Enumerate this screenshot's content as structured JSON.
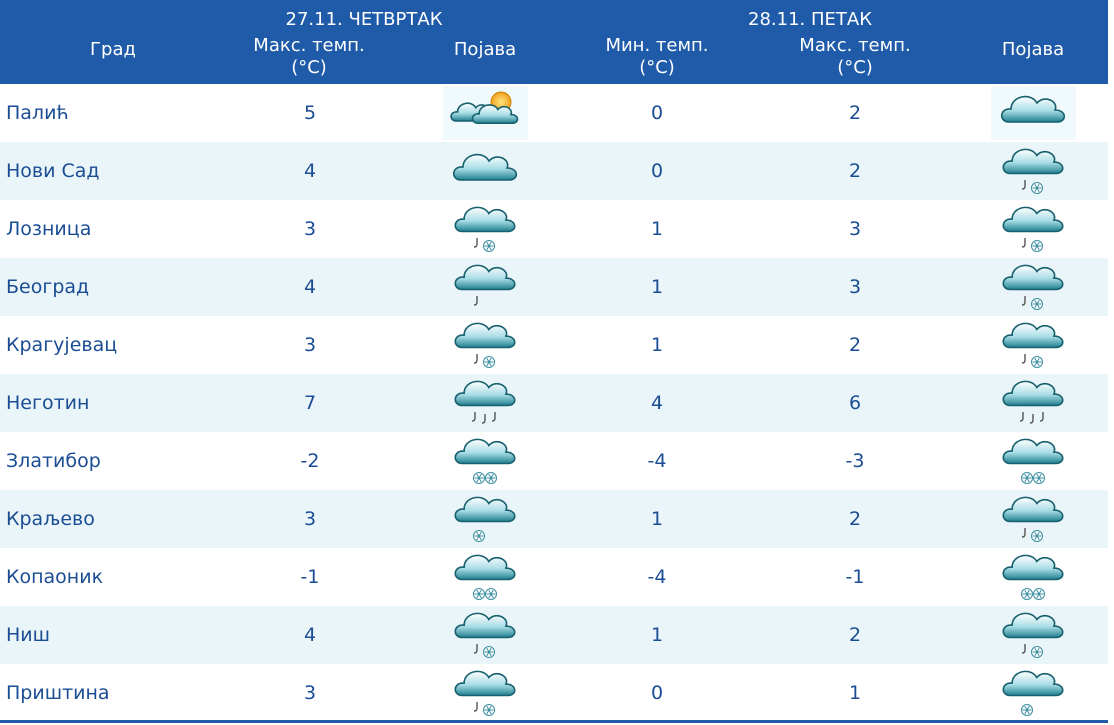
{
  "header": {
    "date1": "27.11. ЧЕТВРТАК",
    "date2": "28.11. ПЕТАК",
    "city": "Град",
    "max_temp": "Макс. темп.",
    "min_temp": "Мин. темп.",
    "unit": "(°C)",
    "phenomenon": "Појава"
  },
  "rows": [
    {
      "city": "Палић",
      "max1": "5",
      "icon1": "partly-cloudy-icon",
      "min2": "0",
      "max2": "2",
      "icon2": "cloudy-icon"
    },
    {
      "city": "Нови Сад",
      "max1": "4",
      "icon1": "cloudy-icon",
      "min2": "0",
      "max2": "2",
      "icon2": "sleet-icon"
    },
    {
      "city": "Лозница",
      "max1": "3",
      "icon1": "sleet-icon",
      "min2": "1",
      "max2": "3",
      "icon2": "sleet-icon"
    },
    {
      "city": "Београд",
      "max1": "4",
      "icon1": "light-rain-icon",
      "min2": "1",
      "max2": "3",
      "icon2": "sleet-icon"
    },
    {
      "city": "Крагујевац",
      "max1": "3",
      "icon1": "sleet-icon",
      "min2": "1",
      "max2": "2",
      "icon2": "sleet-icon"
    },
    {
      "city": "Неготин",
      "max1": "7",
      "icon1": "rain-icon",
      "min2": "4",
      "max2": "6",
      "icon2": "rain-icon"
    },
    {
      "city": "Златибор",
      "max1": "-2",
      "icon1": "snow-icon",
      "min2": "-4",
      "max2": "-3",
      "icon2": "snow-icon"
    },
    {
      "city": "Краљево",
      "max1": "3",
      "icon1": "light-snow-icon",
      "min2": "1",
      "max2": "2",
      "icon2": "sleet-icon"
    },
    {
      "city": "Копаоник",
      "max1": "-1",
      "icon1": "snow-icon",
      "min2": "-4",
      "max2": "-1",
      "icon2": "snow-icon"
    },
    {
      "city": "Ниш",
      "max1": "4",
      "icon1": "sleet-icon",
      "min2": "1",
      "max2": "2",
      "icon2": "sleet-icon"
    },
    {
      "city": "Приштина",
      "max1": "3",
      "icon1": "sleet-icon",
      "min2": "0",
      "max2": "1",
      "icon2": "light-snow-icon"
    }
  ],
  "colors": {
    "header_bg": "#1f5ba8",
    "row_alt_bg": "#e9f5f8",
    "text": "#1a4d94"
  }
}
